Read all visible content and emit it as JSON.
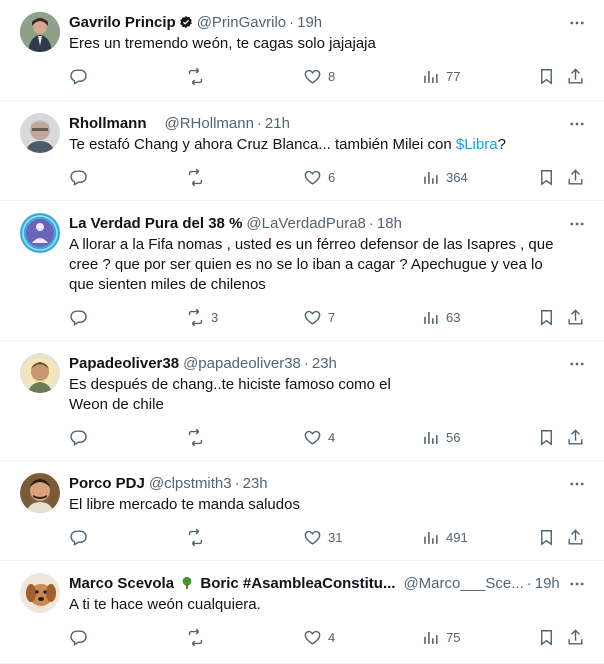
{
  "tweets": [
    {
      "name": "Gavrilo Princip",
      "handle": "@PrinGavrilo",
      "time": "19h",
      "verified": true,
      "text_parts": [
        "Eres un tremendo weón, te cagas solo jajajaja"
      ],
      "replies": "",
      "retweets": "",
      "likes": "8",
      "views": "77"
    },
    {
      "name": "Rhollmann",
      "handle": "@RHollmann",
      "time": "21h",
      "text_parts": [
        "Te estafó Chang y ahora Cruz Blanca... también Milei con ",
        "$Libra",
        "?"
      ],
      "replies": "",
      "retweets": "",
      "likes": "6",
      "views": "364"
    },
    {
      "name": "La Verdad Pura del 38 %",
      "handle": "@LaVerdadPura8",
      "time": "18h",
      "text_parts": [
        "A llorar a la Fifa nomas , usted es un férreo  defensor de las Isapres , que cree ? que por ser quien es no se lo iban a cagar ? Apechugue y vea lo que sienten miles de chilenos"
      ],
      "replies": "",
      "retweets": "3",
      "likes": "7",
      "views": "63"
    },
    {
      "name": "Papadeoliver38",
      "handle": "@papadeoliver38",
      "time": "23h",
      "text_parts": [
        "Es después de chang..te hiciste famoso como el\nWeon de chile"
      ],
      "replies": "",
      "retweets": "",
      "likes": "4",
      "views": "56"
    },
    {
      "name": "Porco PDJ",
      "handle": "@clpstmith3",
      "time": "23h",
      "text_parts": [
        "El libre mercado te manda saludos"
      ],
      "replies": "",
      "retweets": "",
      "likes": "31",
      "views": "491"
    },
    {
      "name_before": "Marco Scevola",
      "name_after": "Boric #AsambleaConstitu...",
      "handle": "@Marco___Sce...",
      "time": "19h",
      "text_parts": [
        "A ti te hace weón cualquiera."
      ],
      "replies": "",
      "retweets": "",
      "likes": "4",
      "views": "75"
    }
  ],
  "colors": {
    "link": "#1d9bf0",
    "secondary": "#536471",
    "text": "#0f1419",
    "divider": "#eff3f4"
  },
  "icons": [
    "more-icon",
    "reply-icon",
    "retweet-icon",
    "like-icon",
    "views-icon",
    "bookmark-icon",
    "share-icon",
    "verified-icon",
    "tree-icon"
  ]
}
